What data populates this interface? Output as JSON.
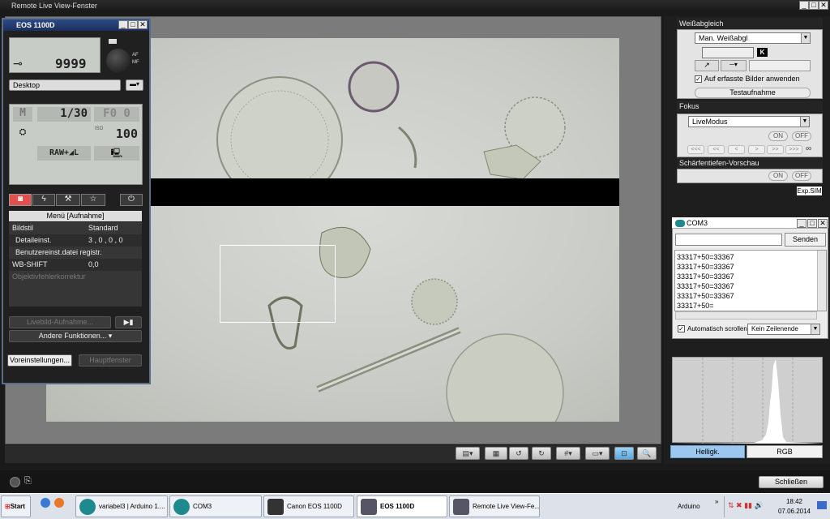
{
  "main_window": {
    "title": "Remote Live View-Fenster"
  },
  "right_panel": {
    "white_balance": {
      "title": "Weißabgleich",
      "mode": "Man. Weißabgl",
      "k_label": "K",
      "apply_checkbox": "Auf erfasste Bilder anwenden",
      "test_button": "Testaufnahme"
    },
    "focus": {
      "title": "Fokus",
      "mode": "LiveModus",
      "on": "ON",
      "off": "OFF",
      "buttons": [
        "<<<",
        "<<",
        "<",
        ">",
        ">>",
        ">>>"
      ],
      "infinity": "∞"
    },
    "dof": {
      "title": "Schärfentiefen-Vorschau",
      "on": "ON",
      "off": "OFF",
      "exp_sim": "Exp.SIM"
    },
    "histogram_tabs": {
      "brightness": "Helligk.",
      "rgb": "RGB"
    }
  },
  "com3": {
    "title": "COM3",
    "send_button": "Senden",
    "lines": [
      "33317+50=33367",
      "33317+50=33367",
      "33317+50=33367",
      "33317+50=33367",
      "33317+50=33367",
      "33317+50="
    ],
    "autoscroll": "Automatisch scrollen",
    "line_ending": "Kein Zeilenende"
  },
  "eos": {
    "title": "EOS 1100D",
    "shots": "9999",
    "save_location": "Desktop",
    "mode": "M",
    "shutter": "1/30",
    "aperture": "F0 0",
    "iso": "100",
    "iso_label": "ISO",
    "quality": "RAW+◢L",
    "menu_title": "Menü [Aufnahme]",
    "menu": [
      {
        "label": "Bildstil",
        "value": "Standard"
      },
      {
        "label": "Detaileinst.",
        "value": "3 , 0 , 0 , 0"
      },
      {
        "label": "Benutzereinst.datei registr.",
        "value": ""
      },
      {
        "label": "WB-SHIFT",
        "value": "0,0"
      },
      {
        "label": "Objektivfehlerkorrektur",
        "value": ""
      }
    ],
    "live_button": "Livebild-Aufnahme...",
    "other_functions": "Andere Funktionen...",
    "preferences": "Voreinstellungen...",
    "main_window_btn": "Hauptfenster"
  },
  "exit_button": "Schließen",
  "taskbar": {
    "start": "Start",
    "tasks": [
      "variabel3 | Arduino 1....",
      "COM3",
      "Canon EOS 1100D",
      "EOS 1100D",
      "Remote Live View-Fe..."
    ],
    "tray_label": "Arduino",
    "time": "18:42",
    "date": "07.06.2014"
  },
  "colors": {
    "eos_title": "#2c4a86",
    "selected_tab": "#9cc7ef",
    "camera_tab": "#e25050"
  }
}
